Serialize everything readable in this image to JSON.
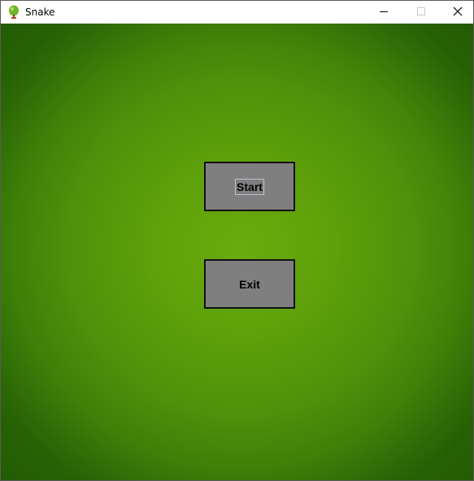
{
  "window": {
    "title": "Snake",
    "icon": "snake-apple-icon",
    "controls": [
      "minimize-icon",
      "maximize-icon",
      "close-icon"
    ]
  },
  "menu": {
    "start_label": "Start",
    "exit_label": "Exit",
    "focused": "Start"
  },
  "colors": {
    "background_green": "#5ea10a",
    "button_gray": "#7f7f7f",
    "button_border": "#111111"
  }
}
